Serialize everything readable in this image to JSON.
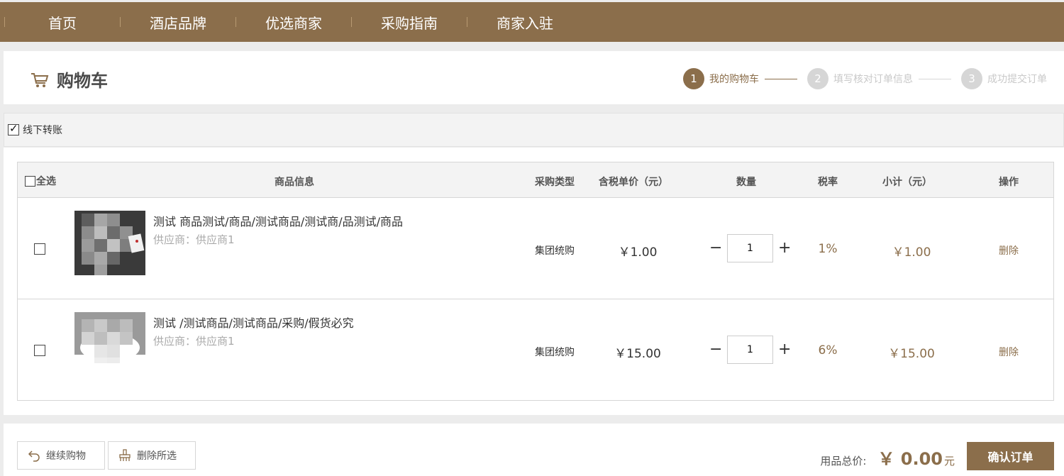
{
  "nav": {
    "items": [
      "首页",
      "酒店品牌",
      "优选商家",
      "采购指南",
      "商家入驻"
    ]
  },
  "header": {
    "title": "购物车",
    "steps": [
      {
        "num": "1",
        "label": "我的购物车"
      },
      {
        "num": "2",
        "label": "填写核对订单信息"
      },
      {
        "num": "3",
        "label": "成功提交订单"
      }
    ]
  },
  "payment": {
    "offline_transfer_label": "线下转账",
    "offline_transfer_checked": true
  },
  "table": {
    "select_all": "全选",
    "columns": [
      "商品信息",
      "采购类型",
      "含税单价（元）",
      "数量",
      "税率",
      "小计（元）",
      "操作"
    ],
    "rows": [
      {
        "name": "测试 商品测试/商品/测试商品/测试商/品测试/商品",
        "supplier": "供应商：供应商1",
        "purchase_type": "集团统购",
        "price": "￥1.00",
        "quantity": "1",
        "tax": "1%",
        "subtotal": "￥1.00",
        "action": "删除",
        "checked": false
      },
      {
        "name": "测试 /测试商品/测试商品/采购/假货必究",
        "supplier": "供应商：供应商1",
        "purchase_type": "集团统购",
        "price": "￥15.00",
        "quantity": "1",
        "tax": "6%",
        "subtotal": "￥15.00",
        "action": "删除",
        "checked": false
      }
    ],
    "minus": "−",
    "plus": "+"
  },
  "footer": {
    "continue_label": "继续购物",
    "delete_selected_label": "删除所选",
    "total_label": "用品总价:",
    "total_amount": "￥ 0.00",
    "total_unit": "元",
    "confirm_label": "确认订单"
  },
  "colors": {
    "brand": "#8b6e4b",
    "step_inactive": "#d6d6d6"
  }
}
